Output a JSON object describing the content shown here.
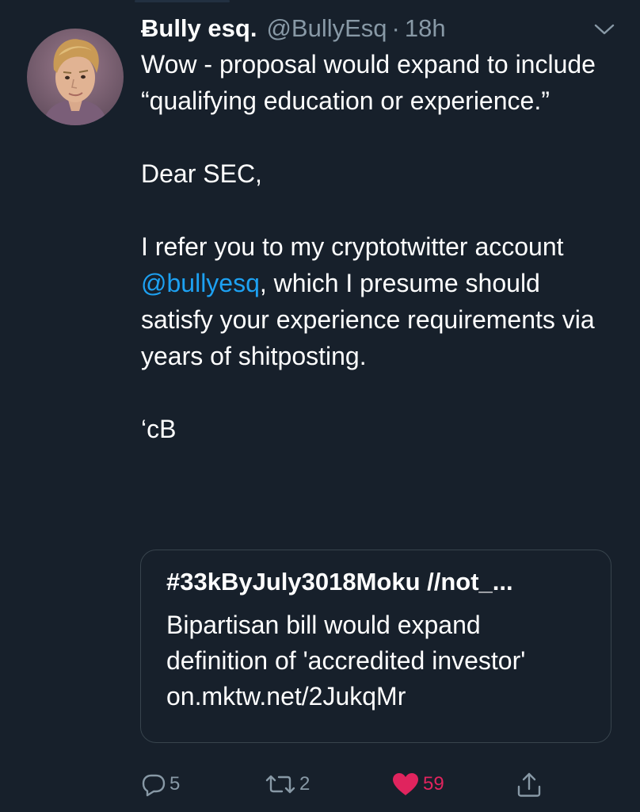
{
  "user": {
    "display_name": "Ƀully esq.",
    "handle": "@BullyEsq",
    "separator": "·",
    "time": "18h"
  },
  "tweet": {
    "paragraph1": "Wow - proposal would expand to include “qualifying education or experience.”",
    "paragraph2": "Dear SEC,",
    "paragraph3_before": "I refer you to my cryptotwitter account ",
    "paragraph3_mention": "@bullyesq",
    "paragraph3_after": ", which I presume should satisfy your experience requirements via years of shitposting.",
    "paragraph4": "‘cB"
  },
  "card": {
    "title": "#33kByJuly3018Moku //not_...",
    "description": "Bipartisan bill would expand definition of 'accredited investor' on.mktw.net/2JukqMr"
  },
  "actions": {
    "reply_count": "5",
    "retweet_count": "2",
    "like_count": "59"
  },
  "icons": {
    "reply": "reply-icon",
    "retweet": "retweet-icon",
    "like": "heart-icon",
    "share": "share-icon",
    "caret": "chevron-down-icon"
  },
  "colors": {
    "background": "#17202b",
    "text": "#ffffff",
    "muted": "#8899a6",
    "link": "#1da1f2",
    "like": "#e0245e",
    "border": "#38444d"
  }
}
